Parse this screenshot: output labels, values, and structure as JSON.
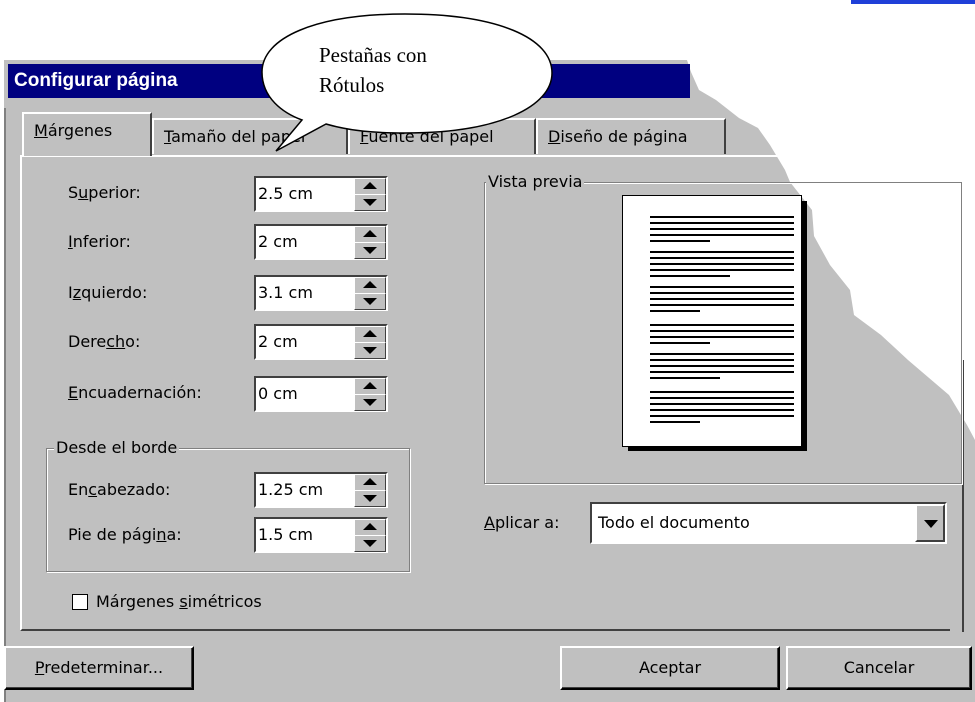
{
  "window": {
    "title": "Configurar página"
  },
  "callout": {
    "line1": "Pestañas con",
    "line2": "Rótulos"
  },
  "tabs": [
    {
      "pre": "",
      "key": "M",
      "post": "árgenes"
    },
    {
      "pre": "",
      "key": "T",
      "post": "amaño del papel"
    },
    {
      "pre": "",
      "key": "F",
      "post": "uente del papel"
    },
    {
      "pre": "",
      "key": "D",
      "post": "iseño de página"
    }
  ],
  "margins": {
    "superior": {
      "pre": "S",
      "key": "u",
      "post": "perior:",
      "value": "2.5 cm"
    },
    "inferior": {
      "pre": "",
      "key": "I",
      "post": "nferior:",
      "value": "2 cm"
    },
    "izquierdo": {
      "pre": "I",
      "key": "z",
      "post": "quierdo:",
      "value": "3.1 cm"
    },
    "derecho": {
      "pre": "Dere",
      "key": "ch",
      "post": "o:",
      "value": "2 cm"
    },
    "encuadernacion": {
      "pre": "",
      "key": "E",
      "post": "ncuadernación:",
      "value": "0 cm"
    }
  },
  "desde_borde": {
    "title": "Desde el borde",
    "encabezado": {
      "pre": "En",
      "key": "c",
      "post": "abezado:",
      "value": "1.25 cm"
    },
    "pie": {
      "pre": "Pie de pági",
      "key": "n",
      "post": "a:",
      "value": "1.5 cm"
    }
  },
  "symmetric": {
    "pre": "Márgenes ",
    "key": "s",
    "post": "imétricos",
    "checked": false
  },
  "preview": {
    "title": "Vista previa"
  },
  "apply": {
    "pre": "",
    "key": "A",
    "post": "plicar a:",
    "value": "Todo el documento"
  },
  "buttons": {
    "default": {
      "pre": "",
      "key": "P",
      "post": "redeterminar..."
    },
    "ok": "Aceptar",
    "cancel": "Cancelar"
  },
  "colors": {
    "titlebar": "#000080",
    "dialog": "#c0c0c0",
    "link": "#1f3fd8"
  }
}
